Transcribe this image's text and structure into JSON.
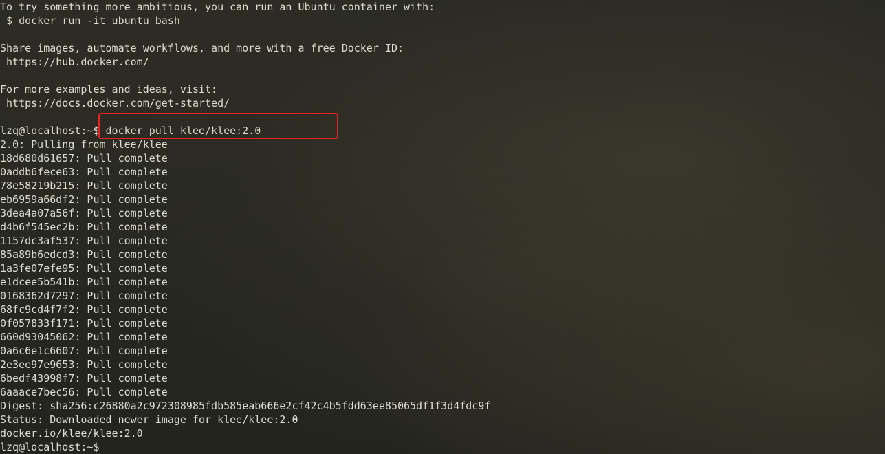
{
  "terminal": {
    "lines": [
      "To try something more ambitious, you can run an Ubuntu container with:",
      " $ docker run -it ubuntu bash",
      "",
      "Share images, automate workflows, and more with a free Docker ID:",
      " https://hub.docker.com/",
      "",
      "For more examples and ideas, visit:",
      " https://docs.docker.com/get-started/",
      "",
      "lzq@localhost:~$ docker pull klee/klee:2.0",
      "2.0: Pulling from klee/klee",
      "18d680d61657: Pull complete",
      "0addb6fece63: Pull complete",
      "78e58219b215: Pull complete",
      "eb6959a66df2: Pull complete",
      "3dea4a07a56f: Pull complete",
      "d4b6f545ec2b: Pull complete",
      "1157dc3af537: Pull complete",
      "85a89b6edcd3: Pull complete",
      "1a3fe07efe95: Pull complete",
      "e1dcee5b541b: Pull complete",
      "0168362d7297: Pull complete",
      "68fc9cd4f7f2: Pull complete",
      "0f057833f171: Pull complete",
      "660d93045062: Pull complete",
      "0a6c6e1c6607: Pull complete",
      "2e3ee97e9653: Pull complete",
      "6bedf43998f7: Pull complete",
      "6aaace7bec56: Pull complete",
      "Digest: sha256:c26880a2c972308985fdb585eab666e2cf42c4b5fdd63ee85065df1f3d4fdc9f",
      "Status: Downloaded newer image for klee/klee:2.0",
      "docker.io/klee/klee:2.0",
      "lzq@localhost:~$"
    ]
  },
  "colors": {
    "text": "#dcdcd2",
    "highlight_border": "#e62222",
    "background": "#262621"
  }
}
